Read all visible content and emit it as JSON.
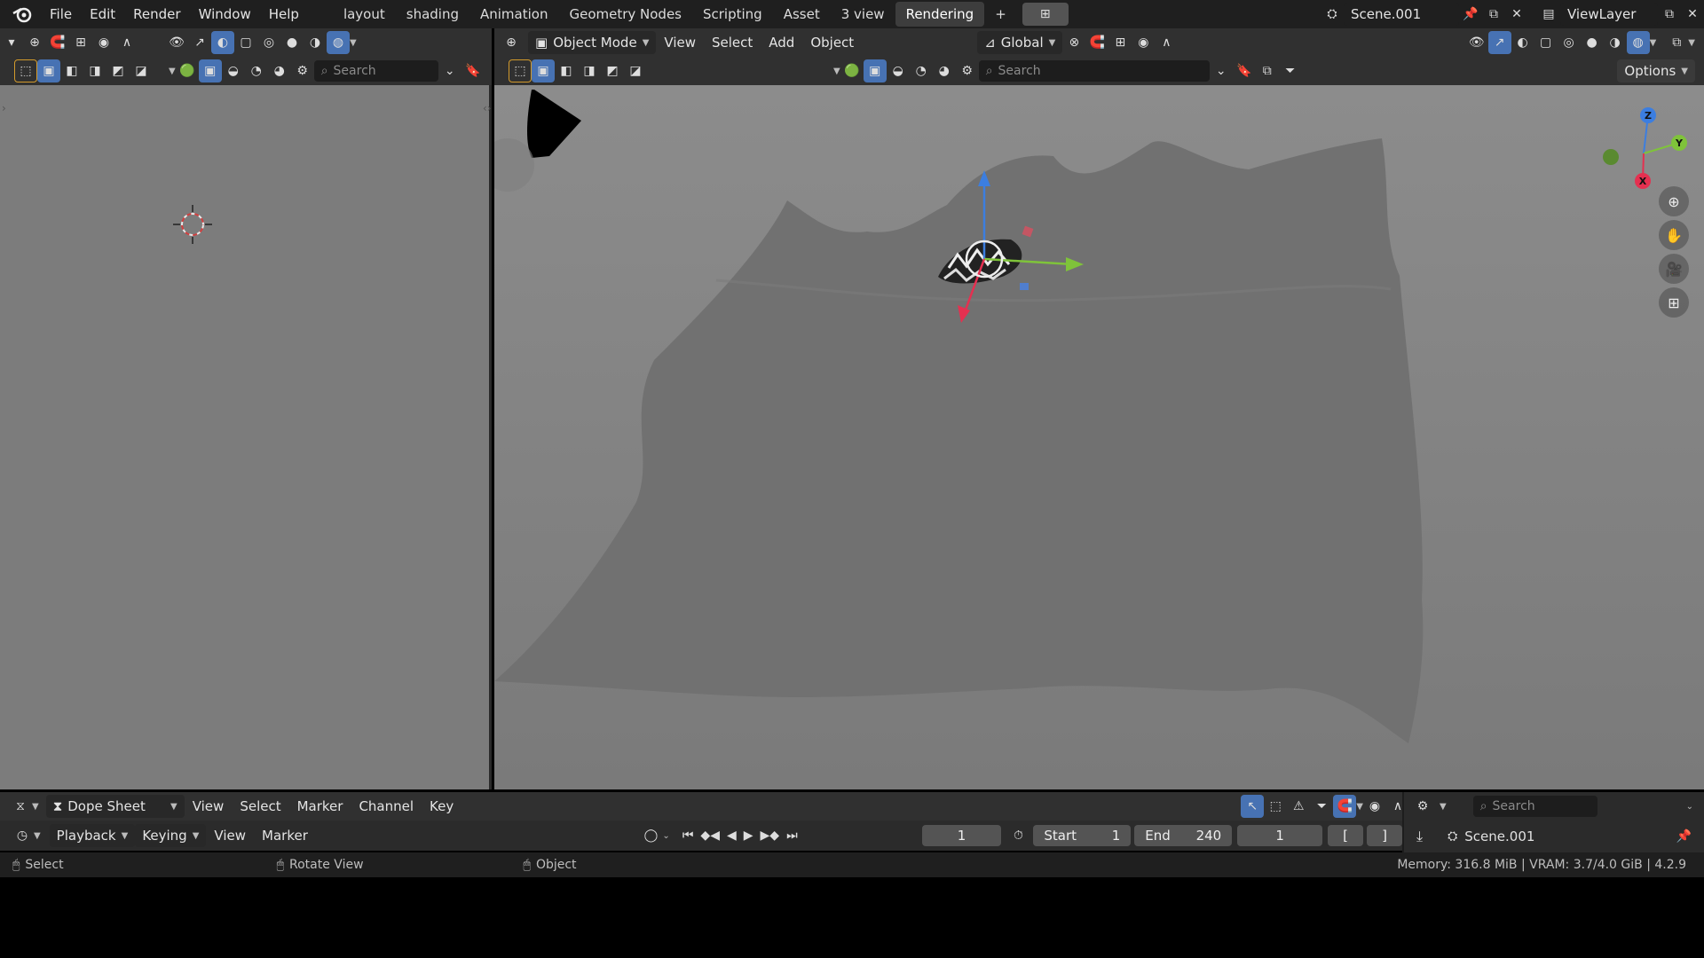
{
  "topbar": {
    "menus": [
      "File",
      "Edit",
      "Render",
      "Window",
      "Help"
    ],
    "workspaces": [
      "layout",
      "shading",
      "Animation",
      "Geometry Nodes",
      "Scripting",
      "Asset",
      "3 view",
      "Rendering"
    ],
    "active_workspace": "Rendering",
    "add_tab": "+",
    "scene": "Scene.001",
    "view_layer": "ViewLayer"
  },
  "left_header": {
    "search_placeholder": "Search"
  },
  "main_header": {
    "mode": "Object Mode",
    "menus": [
      "View",
      "Select",
      "Add",
      "Object"
    ],
    "transform_orientation": "Global",
    "search_placeholder": "Search",
    "options": "Options"
  },
  "gizmo": {
    "z": "Z",
    "y": "Y",
    "x": "X"
  },
  "dopesheet": {
    "editor": "Dope Sheet",
    "menus": [
      "View",
      "Select",
      "Marker",
      "Channel",
      "Key"
    ],
    "search_placeholder": "Search"
  },
  "timeline": {
    "menus": [
      "Playback",
      "Keying",
      "View",
      "Marker"
    ],
    "current_frame": "1",
    "start_label": "Start",
    "start": "1",
    "end_label": "End",
    "end": "240",
    "frame_field": "1",
    "bracket_open": "[",
    "bracket_close": "]"
  },
  "outliner": {
    "scene": "Scene.001"
  },
  "status": {
    "select": "Select",
    "rotate": "Rotate View",
    "object": "Object",
    "memory": "Memory: 316.8 MiB | VRAM: 3.7/4.0 GiB | 4.2.9"
  },
  "colors": {
    "accent": "#4772b3",
    "axis_x": "#e53050",
    "axis_y": "#7fc33a",
    "axis_z": "#3c7ee0"
  }
}
